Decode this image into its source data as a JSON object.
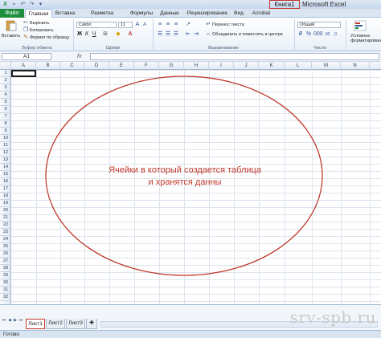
{
  "window": {
    "book_title": "Книга1",
    "app_title": "Microsoft Excel"
  },
  "tabs": [
    {
      "label": "Файл"
    },
    {
      "label": "Главная"
    },
    {
      "label": "Вставка"
    },
    {
      "label": "Разметка страницы"
    },
    {
      "label": "Формулы"
    },
    {
      "label": "Данные"
    },
    {
      "label": "Рецензирование"
    },
    {
      "label": "Вид"
    },
    {
      "label": "Acrobat"
    }
  ],
  "ribbon": {
    "clipboard": {
      "paste_label": "Вставить",
      "cut_label": "Вырезать",
      "copy_label": "Копировать",
      "format_painter_label": "Формат по образцу",
      "group_label": "Буфер обмена"
    },
    "font": {
      "font_name": "Calibri",
      "font_size": "11",
      "group_label": "Шрифт"
    },
    "alignment": {
      "wrap_text_label": "Перенос текста",
      "merge_center_label": "Объединить и поместить в центре",
      "group_label": "Выравнивание"
    },
    "number": {
      "format_value": "Общий",
      "group_label": "Число"
    },
    "styles": {
      "conditional_label": "Условное форматирование"
    }
  },
  "formula_bar": {
    "name_box": "A1",
    "fx_label": "fx",
    "value": ""
  },
  "columns": [
    "A",
    "B",
    "C",
    "D",
    "E",
    "F",
    "G",
    "H",
    "I",
    "J",
    "K",
    "L",
    "M",
    "N"
  ],
  "rows": [
    "1",
    "2",
    "3",
    "4",
    "5",
    "6",
    "7",
    "8",
    "9",
    "10",
    "11",
    "12",
    "13",
    "14",
    "15",
    "16",
    "17",
    "18",
    "19",
    "20",
    "21",
    "22",
    "23",
    "24",
    "25",
    "26",
    "27",
    "28",
    "29",
    "30",
    "31",
    "32"
  ],
  "annotation": {
    "text_line1": "Ячейки в который создается таблица",
    "text_line2": "и хранятся данны",
    "color": "#c0392b"
  },
  "sheets": [
    {
      "label": "Лист1",
      "active": true
    },
    {
      "label": "Лист2",
      "active": false
    },
    {
      "label": "Лист3",
      "active": false
    }
  ],
  "status": {
    "text": "Готово"
  },
  "watermark": "srv-spb.ru",
  "colors": {
    "file_tab": "#1f8f3d",
    "accent_red": "#c0392b",
    "ribbon_blue": "#dbe5f1"
  }
}
